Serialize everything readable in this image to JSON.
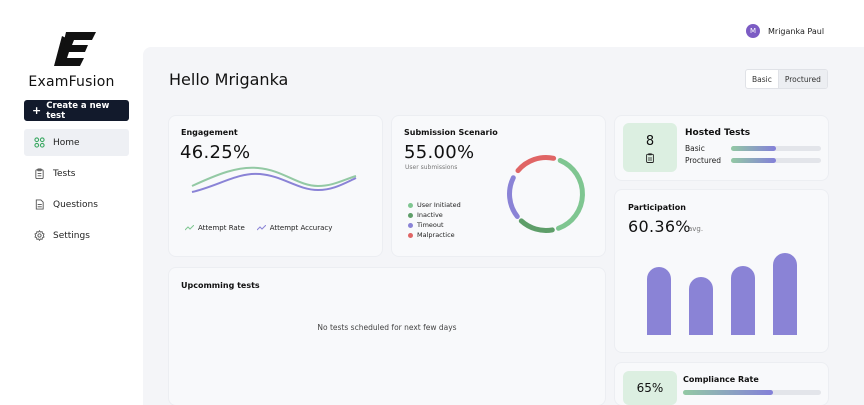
{
  "sidebar": {
    "brand": "ExamFusion",
    "create_button": "Create a new test",
    "nav": [
      {
        "label": "Home",
        "icon": "grid-icon"
      },
      {
        "label": "Tests",
        "icon": "clipboard-icon"
      },
      {
        "label": "Questions",
        "icon": "document-icon"
      },
      {
        "label": "Settings",
        "icon": "gear-icon"
      }
    ]
  },
  "header": {
    "greeting": "Hello Mriganka",
    "user_name": "Mriganka Paul",
    "avatar_initial": "M",
    "mode_options": [
      "Basic",
      "Proctured"
    ],
    "mode_selected": "Proctured"
  },
  "engagement": {
    "title": "Engagement",
    "value": "46.25%",
    "legend": [
      "Attempt Rate",
      "Attempt Accuracy"
    ]
  },
  "submission": {
    "title": "Submission Scenario",
    "value": "55.00%",
    "subtitle": "User submissions",
    "legend": [
      {
        "label": "User Initiated",
        "color": "#7fc691"
      },
      {
        "label": "Inactive",
        "color": "#5e9e69"
      },
      {
        "label": "Timeout",
        "color": "#8a83d6"
      },
      {
        "label": "Malpractice",
        "color": "#e06565"
      }
    ]
  },
  "hosted": {
    "count": "8",
    "title": "Hosted Tests",
    "rows": [
      {
        "label": "Basic",
        "fill": 0.5
      },
      {
        "label": "Proctured",
        "fill": 0.5
      }
    ]
  },
  "participation": {
    "title": "Participation",
    "value": "60.36%",
    "unit": "avg."
  },
  "upcoming": {
    "title": "Upcomming tests",
    "empty": "No tests scheduled for next few days"
  },
  "compliance": {
    "value": "65%",
    "title": "Compliance Rate",
    "fill": 0.65
  },
  "colors": {
    "dark": "#121a2c",
    "green": "#7fc691",
    "purple": "#8480d9",
    "red": "#e06565"
  }
}
